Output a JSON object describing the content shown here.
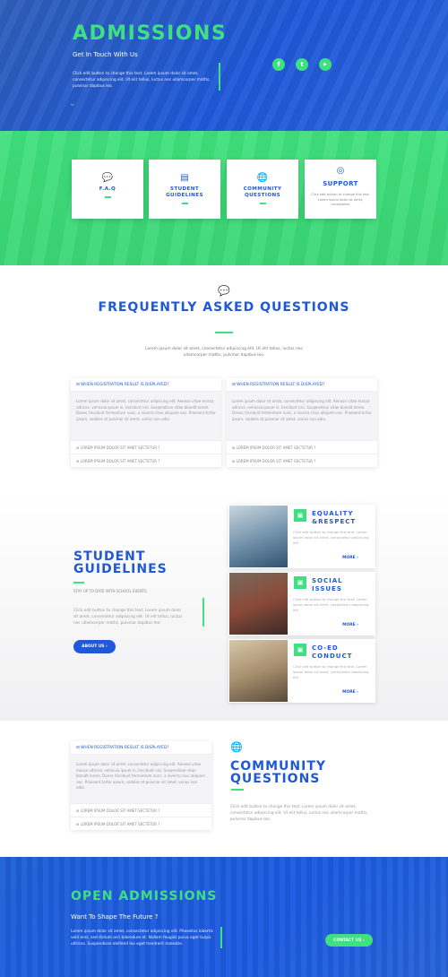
{
  "hero": {
    "title": "ADMISSIONS",
    "subtitle": "Get In Touch With Us",
    "description": "Click edit button to change this text. Lorem ipsum dolor sit amet, consectetur adipiscing elit. Ut elit tellus, luctus nec ullamcorper mattis, pulvinar dapibus leo.",
    "social": [
      "f",
      "t",
      "▶"
    ]
  },
  "cards": [
    {
      "title": "F.A.Q",
      "icon": "chat-icon"
    },
    {
      "title": "STUDENT GUIDELINES",
      "icon": "signpost-icon"
    },
    {
      "title": "COMMUNITY QUESTIONS",
      "icon": "globe-icon"
    },
    {
      "title": "SUPPORT",
      "icon": "lifebuoy-icon",
      "description": "Click edit button to change this text. Lorem ipsum dolor sit amet, consectetur"
    }
  ],
  "faq": {
    "title": "FREQUENTLY ASKED QUESTIONS",
    "description": "Lorem ipsum dolor sit amet, consectetur adipiscing elit. Ut elit tellus, luctus nec ullamcorper mattis, pulvinar dapibus leo.",
    "accordions": [
      {
        "header": "WHEN REGISTRATION RESULT IS DISPLAYED?",
        "body": "Lorem ipsum dolor sit amet, consectetur adipiscing elit. Aenean vitae massa ultrices, vehicula ipsum in, tincidunt nisi. Suspendisse vitae blandit lorem. Donec tincidunt fermentum nunc, a viverra risus aliquam nec. Praesent tortor ipsum, sodales at pulvinar sit amet, varius non odio.",
        "items": [
          "LOREM IPSUM DOLOR SIT AMET SECTETUR ?",
          "LOREM IPSUM DOLOR SIT AMET SECTETUR ?"
        ]
      },
      {
        "header": "WHEN REGISTRATION RESULT IS DISPLAYED?",
        "body": "Lorem ipsum dolor sit amet, consectetur adipiscing elit. Aenean vitae massa ultrices, vehicula ipsum in, tincidunt nisi. Suspendisse vitae blandit lorem. Donec tincidunt fermentum nunc, a viverra risus aliquam nec. Praesent tortor ipsum, sodales at pulvinar sit amet, varius non odio.",
        "items": [
          "LOREM IPSUM DOLOR SIT AMET SECTETUR ?",
          "LOREM IPSUM DOLOR SIT AMET SECTETUR ?"
        ]
      }
    ]
  },
  "guidelines": {
    "title": "STUDENT GUIDELINES",
    "subtitle": "STAY UP TO DATE WITH SCHOOL EVENTS",
    "description": "Click edit button to change this text. Lorem ipsum dolor sit amet, consectetur adipiscing elit. Ut elit tellus, luctus nec ullamcorper mattis, pulvinar dapibus leo.",
    "button": "ABOUT US ›",
    "items": [
      {
        "title": "EQUALITY &RESPECT",
        "description": "Click edit button to change this text. Lorem ipsum dolor sit amet, consectetur adipiscing elit",
        "more": "MORE ›",
        "photo_color": "#6f8fa8"
      },
      {
        "title": "SOCIAL ISSUES",
        "description": "Click edit button to change this text. Lorem ipsum dolor sit amet, consectetur adipiscing elit",
        "more": "MORE ›",
        "photo_color": "#8a4a3a"
      },
      {
        "title": "CO-ED CONDUCT",
        "description": "Click edit button to change this text. Lorem ipsum dolor sit amet, consectetur adipiscing elit",
        "more": "MORE ›",
        "photo_color": "#a89070"
      }
    ]
  },
  "community": {
    "title": "COMMUNITY QUESTIONS",
    "description": "Click edit button to change this text. Lorem ipsum dolor sit amet, consectetur adipiscing elit. Ut elit tellus, luctus nec ullamcorper mattis, pulvinar dapibus leo.",
    "accordion": {
      "header": "WHEN REGISTRATION RESULT IS DISPLAYED?",
      "body": "Lorem ipsum dolor sit amet, consectetur adipiscing elit. Aenean vitae massa ultrices, vehicula ipsum in, tincidunt nisi. Suspendisse vitae blandit lorem. Donec tincidunt fermentum nunc, a viverra risus aliquam nec. Praesent tortor ipsum, sodales at pulvinar sit amet, varius non odio.",
      "items": [
        "LOREM IPSUM DOLOR SIT AMET SECTETUR ?",
        "LOREM IPSUM DOLOR SIT AMET SECTETUR ?"
      ]
    }
  },
  "open": {
    "title": "OPEN ADMISSIONS",
    "subtitle": "Want To Shape The Future ?",
    "description": "Lorem ipsum dolor sit amet, consectetur adipiscing elit. Phasellus lobortis velit erat, sed dictum orci bibendum et. Nullam feugiat purus eget turpis ultrices. Suspendisse eleifend leo eget hendrerit molestie.",
    "button": "CONTACT US ›"
  },
  "colors": {
    "blue": "#1f58d8",
    "green": "#3ee07f"
  }
}
